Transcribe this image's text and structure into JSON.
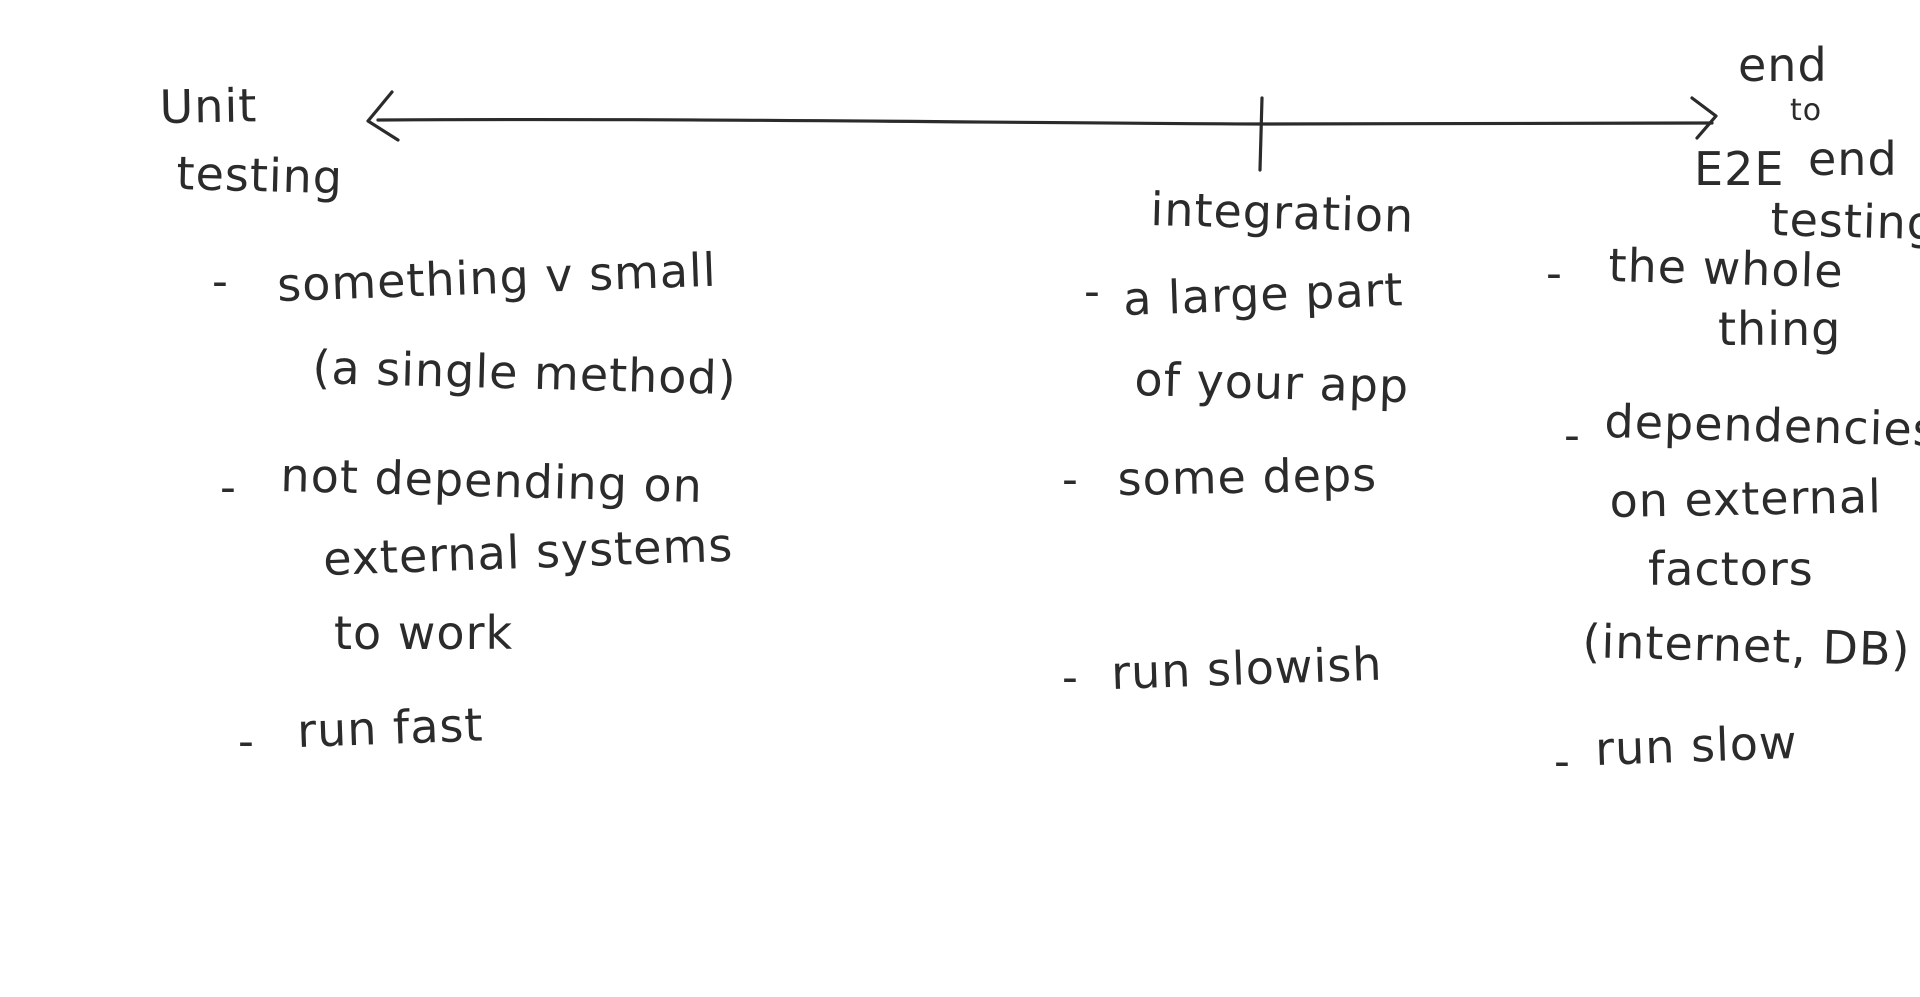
{
  "axis": {
    "left_label": [
      "Unit",
      "testing"
    ],
    "middle_label": "integration",
    "right_label_abbrev": "E2E",
    "right_label": [
      "end",
      "to",
      "end",
      "testing"
    ]
  },
  "unit": {
    "bullets": [
      {
        "dash": "-",
        "lines": [
          "something v small",
          "(a single method)"
        ]
      },
      {
        "dash": "-",
        "lines": [
          "not depending on",
          "external systems",
          "to work"
        ]
      },
      {
        "dash": "-",
        "lines": [
          "run fast"
        ]
      }
    ]
  },
  "integration": {
    "bullets": [
      {
        "dash": "-",
        "lines": [
          "a large part",
          "of your app"
        ]
      },
      {
        "dash": "-",
        "lines": [
          "some deps"
        ]
      },
      {
        "dash": "-",
        "lines": [
          "run slowish"
        ]
      }
    ]
  },
  "e2e": {
    "bullets": [
      {
        "dash": "-",
        "lines": [
          "the whole",
          "thing"
        ]
      },
      {
        "dash": "-",
        "lines": [
          "dependencies",
          "on external",
          "factors",
          "(internet, DB)"
        ]
      },
      {
        "dash": "-",
        "lines": [
          "run slow"
        ]
      }
    ]
  },
  "colors": {
    "ink": "#2b2b2b",
    "background": "#ffffff"
  }
}
